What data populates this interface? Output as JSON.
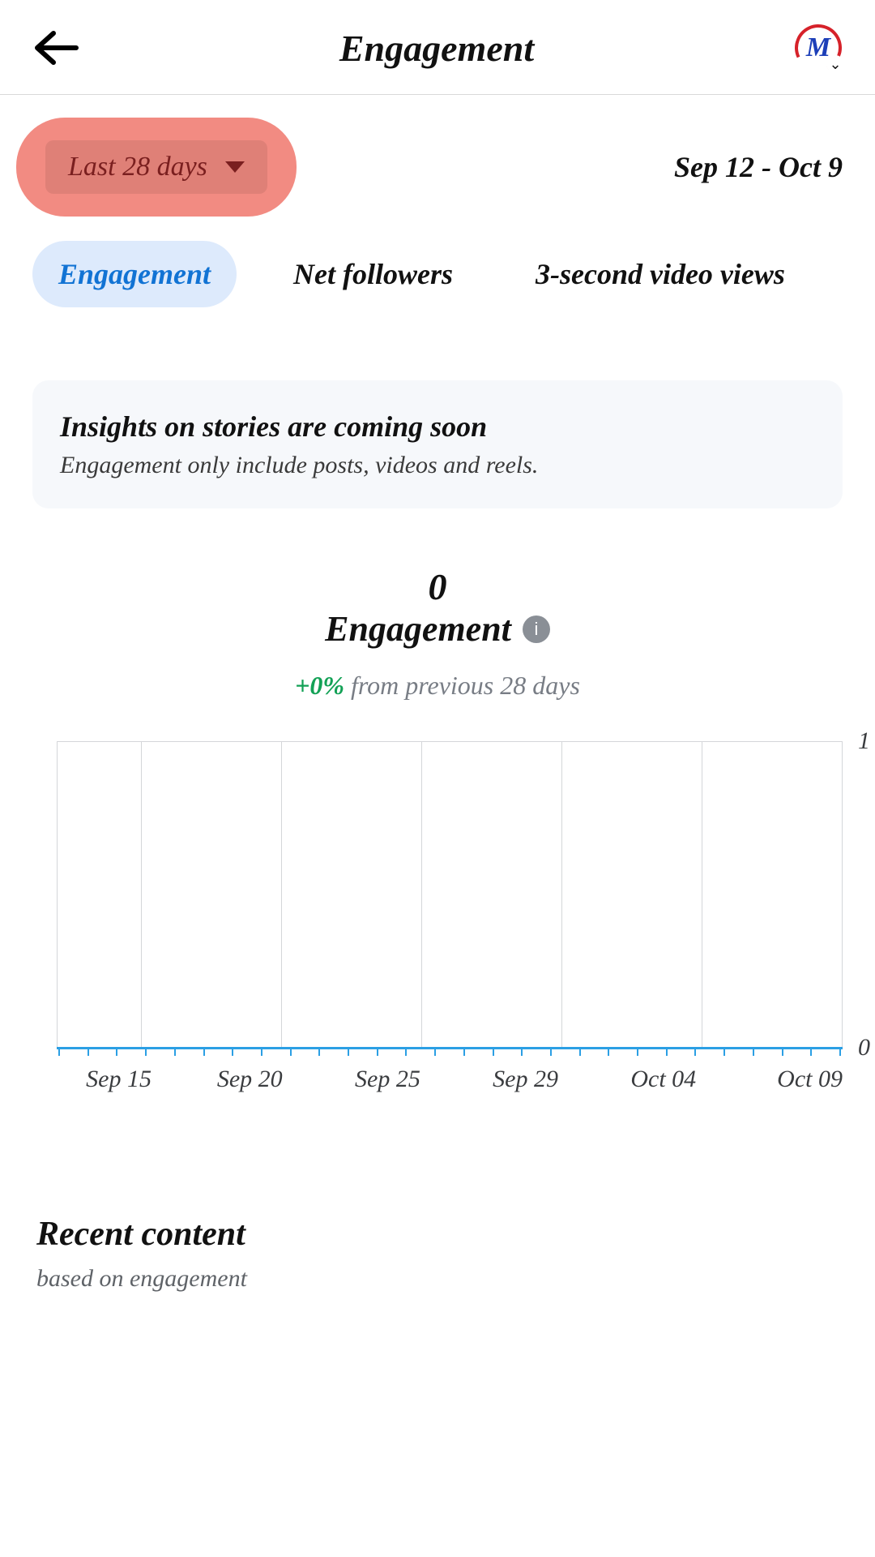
{
  "header": {
    "title": "Engagement",
    "avatar_letter": "M"
  },
  "date_range": {
    "selector_label": "Last 28 days",
    "range_text": "Sep 12 - Oct 9"
  },
  "tabs": [
    {
      "label": "Engagement",
      "active": true
    },
    {
      "label": "Net followers",
      "active": false
    },
    {
      "label": "3-second video views",
      "active": false
    }
  ],
  "notice": {
    "title": "Insights on stories are coming soon",
    "subtitle": "Engagement only include posts, videos and reels."
  },
  "metric": {
    "value": "0",
    "label": "Engagement",
    "delta_value": "+0%",
    "delta_note": "from previous 28 days"
  },
  "recent": {
    "title": "Recent content",
    "subtitle": "based on engagement"
  },
  "chart_data": {
    "type": "line",
    "title": "Engagement",
    "ylabel": "",
    "xlabel": "",
    "ylim": [
      0,
      1
    ],
    "y_ticks": [
      "1",
      "0"
    ],
    "categories": [
      "Sep 15",
      "Sep 20",
      "Sep 25",
      "Sep 29",
      "Oct 04",
      "Oct 09"
    ],
    "series": [
      {
        "name": "Engagement",
        "x": [
          "Sep 12",
          "Sep 13",
          "Sep 14",
          "Sep 15",
          "Sep 16",
          "Sep 17",
          "Sep 18",
          "Sep 19",
          "Sep 20",
          "Sep 21",
          "Sep 22",
          "Sep 23",
          "Sep 24",
          "Sep 25",
          "Sep 26",
          "Sep 27",
          "Sep 28",
          "Sep 29",
          "Sep 30",
          "Oct 01",
          "Oct 02",
          "Oct 03",
          "Oct 04",
          "Oct 05",
          "Oct 06",
          "Oct 07",
          "Oct 08",
          "Oct 09"
        ],
        "values": [
          0,
          0,
          0,
          0,
          0,
          0,
          0,
          0,
          0,
          0,
          0,
          0,
          0,
          0,
          0,
          0,
          0,
          0,
          0,
          0,
          0,
          0,
          0,
          0,
          0,
          0,
          0,
          0
        ]
      }
    ]
  }
}
